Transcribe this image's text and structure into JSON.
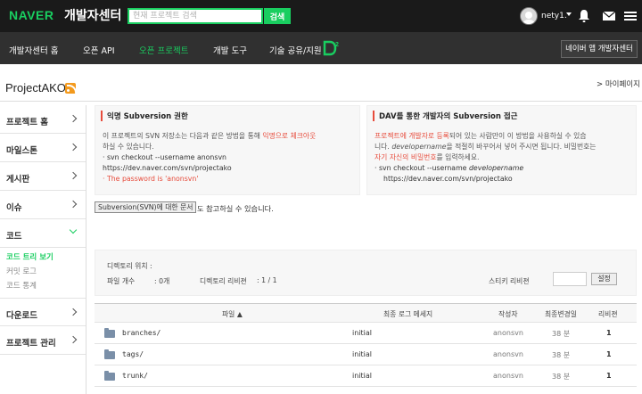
{
  "header": {
    "logo": "NAVER",
    "logo_sub": "개발자센터",
    "search_placeholder": "현재 프로젝트 검색",
    "search_button": "검색",
    "username": "nety1."
  },
  "nav": {
    "items": [
      "개발자센터 홈",
      "오픈 API",
      "오픈 프로젝트",
      "개발 도구",
      "기술 공유/지원"
    ],
    "active_index": 2,
    "app_button": "네이버 앱 개발자센터"
  },
  "project": {
    "title": "ProjectAKO",
    "mypage": "> 마이페이지"
  },
  "sidebar": {
    "items": [
      {
        "label": "프로젝트 홈"
      },
      {
        "label": "마일스톤"
      },
      {
        "label": "게시판"
      },
      {
        "label": "이슈"
      },
      {
        "label": "코드"
      }
    ],
    "sub_items": [
      "코드 트리 보기",
      "커밋 로그",
      "코드 통계"
    ],
    "after_items": [
      {
        "label": "다운로드"
      },
      {
        "label": "프로젝트 관리"
      }
    ]
  },
  "anon_box": {
    "title": "익명 Subversion 권한",
    "line1_a": "이 프로젝트의 SVN 저장소는 다음과 같은 방법을 통해 ",
    "line1_red": "익명으로 체크아웃",
    "line2": "하실 수 있습니다.",
    "bullet1": "svn checkout --username anonsvn https://dev.naver.com/svn/projectako",
    "bullet2": "The password is 'anonsvn'"
  },
  "dav_box": {
    "title": "DAV를 통한 개발자의 Subversion 접근",
    "line1_red": "프로젝트에 개발자로 등록",
    "line1_b": "되어 있는 사람만이 이 방법을 사용하실 수 있습",
    "line2_a": "니다. ",
    "line2_italic": "developername",
    "line2_b": "을 적절히 바꾸어서 넣어 주시면 됩니다. 비밀번호는",
    "line3_red": "자기 자신의 비밀번호",
    "line3_b": "를 입력하세요.",
    "bullet_a": "svn checkout --username ",
    "bullet_italic": "developername",
    "bullet_b": "https://dev.naver.com/svn/projectako"
  },
  "svn_doc": {
    "button": "Subversion(SVN)에 대한 문서",
    "suffix": "도 참고하실 수 있습니다."
  },
  "dir_info": {
    "location_label": "디렉토리 위치 :",
    "file_count_label": "파일 개수",
    "file_count_value": ": 0개",
    "revision_label": "디렉토리 리비젼",
    "revision_value": ": 1 / 1",
    "sticky_label": "스티키 리비젼",
    "goto_button": "설정"
  },
  "table": {
    "headers": [
      "파일 ▲",
      "최종 로그 메세지",
      "작성자",
      "최종변경일",
      "리비젼"
    ],
    "rows": [
      {
        "name": "branches/",
        "log": "initial",
        "author": "anonsvn",
        "date": "38 분",
        "rev": "1"
      },
      {
        "name": "tags/",
        "log": "initial",
        "author": "anonsvn",
        "date": "38 분",
        "rev": "1"
      },
      {
        "name": "trunk/",
        "log": "initial",
        "author": "anonsvn",
        "date": "38 분",
        "rev": "1"
      }
    ]
  },
  "colors": {
    "brand_green": "#19ce60",
    "accent_red": "#e74c3c",
    "topbar_bg": "#1a1a1a",
    "navbar_bg": "#303030"
  }
}
